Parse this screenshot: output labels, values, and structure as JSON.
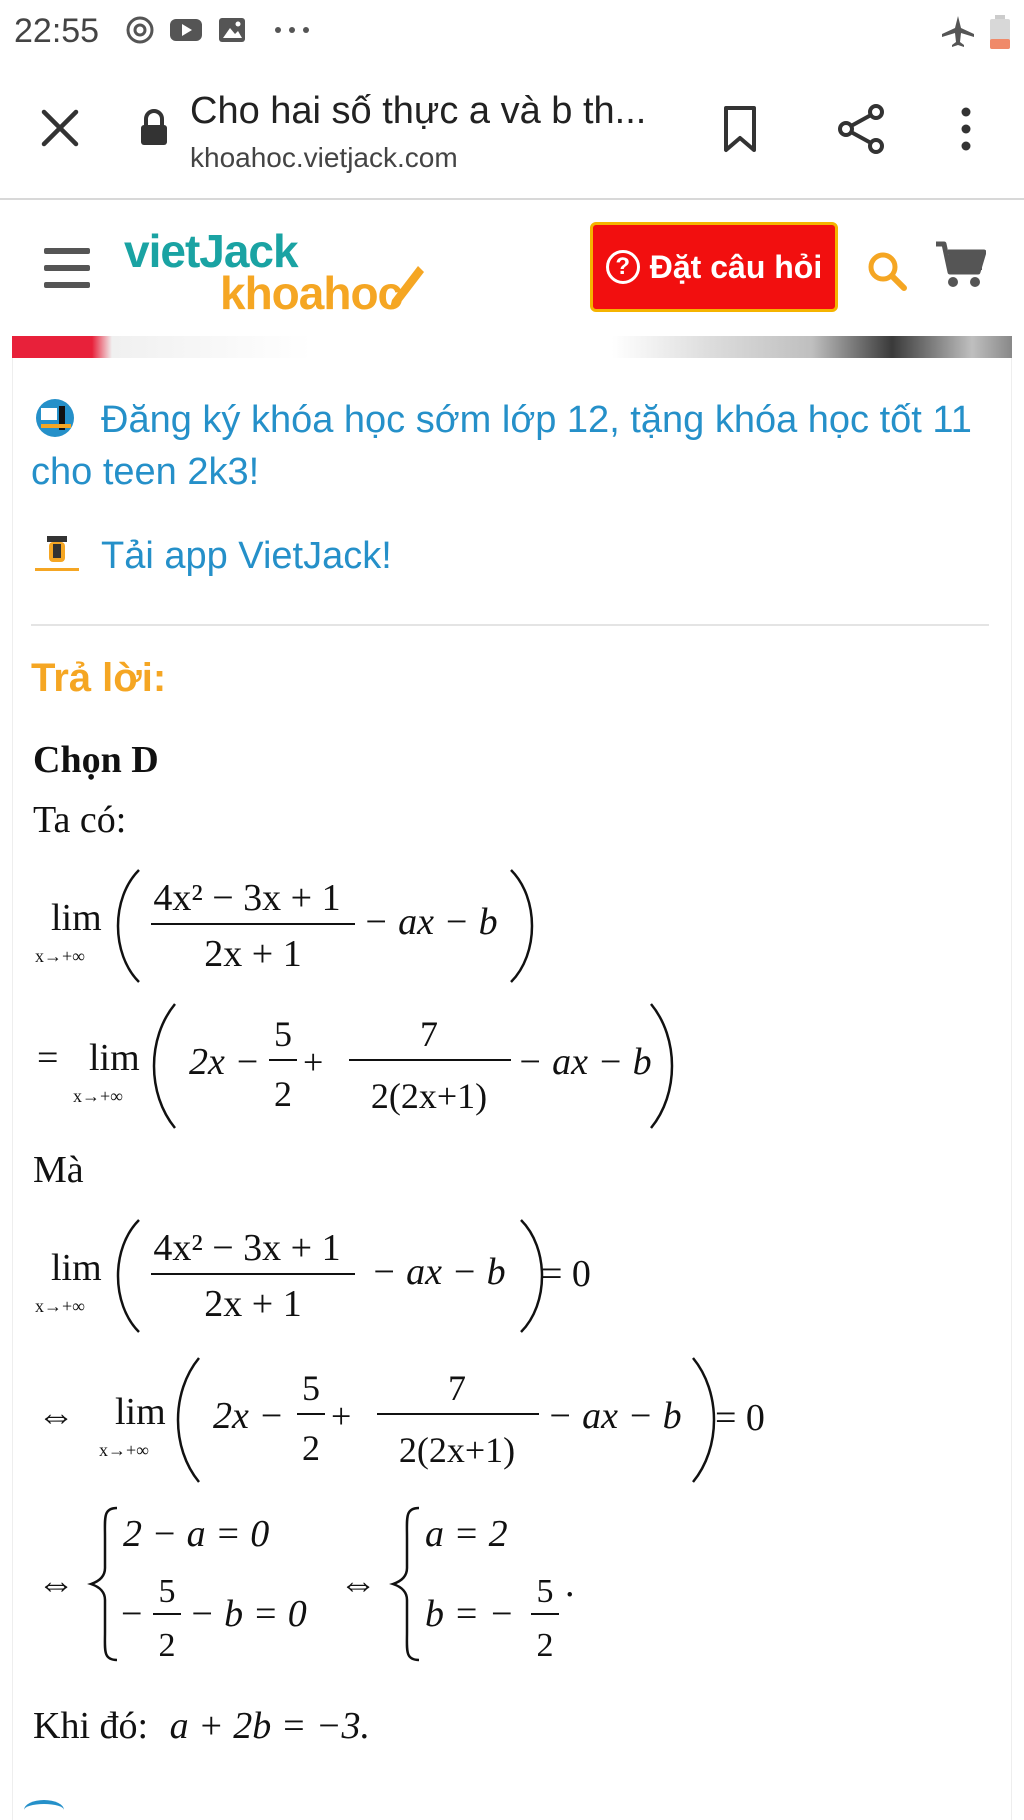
{
  "status_bar": {
    "time": "22:55",
    "icons": [
      "sync-icon",
      "youtube-icon",
      "image-icon",
      "more-dots-icon",
      "airplane-icon",
      "battery-low-icon"
    ]
  },
  "browser": {
    "page_title": "Cho hai số thực a và b th...",
    "url": "khoahoc.vietjack.com"
  },
  "site_header": {
    "logo_top": "vietJack",
    "logo_bottom": "khoahoc",
    "ask_button_label": "Đặt câu hỏi",
    "ask_button_symbol": "?"
  },
  "promo": {
    "course_link": "Đăng ký khóa học sớm lớp 12, tặng khóa học tốt 11 cho teen 2k3!",
    "app_link": "Tải app VietJack!"
  },
  "answer": {
    "heading": "Trả lời:",
    "choice": "Chọn D",
    "intro": "Ta có:",
    "connector": "Mà",
    "conclusion_prefix": "Khi đó:",
    "conclusion_expr": "a + 2b = −3.",
    "eq1": {
      "lim": "lim",
      "sub": "x→+∞",
      "num": "4x² − 3x + 1",
      "den": "2x + 1",
      "tail": "− ax − b"
    },
    "eq2": {
      "lead": "=",
      "lim": "lim",
      "sub": "x→+∞",
      "part1": "2x −",
      "f1_num": "5",
      "f1_den": "2",
      "plus": "+",
      "f2_num": "7",
      "f2_den": "2(2x+1)",
      "tail": "− ax − b"
    },
    "eq3": {
      "lim": "lim",
      "sub": "x→+∞",
      "num": "4x² − 3x + 1",
      "den": "2x + 1",
      "tail": "− ax − b",
      "rhs": "= 0"
    },
    "eq4": {
      "lead": "⇔",
      "lim": "lim",
      "sub": "x→+∞",
      "part1": "2x −",
      "f1_num": "5",
      "f1_den": "2",
      "plus": "+",
      "f2_num": "7",
      "f2_den": "2(2x+1)",
      "tail": "− ax − b",
      "rhs": "= 0"
    },
    "eq5": {
      "lead": "⇔",
      "sys1_line1": "2 − a = 0",
      "sys1_line2_minus": "−",
      "sys1_line2_num": "5",
      "sys1_line2_den": "2",
      "sys1_line2_tail": "− b = 0",
      "mid": "⇔",
      "sys2_line1": "a = 2",
      "sys2_line2_lead": "b = −",
      "sys2_line2_num": "5",
      "sys2_line2_den": "2",
      "sys2_end": "."
    }
  },
  "colors": {
    "teal_logo": "#1aa3a3",
    "orange": "#f5a623",
    "ask_red": "#f20f0f",
    "link_blue": "#2590c9"
  }
}
